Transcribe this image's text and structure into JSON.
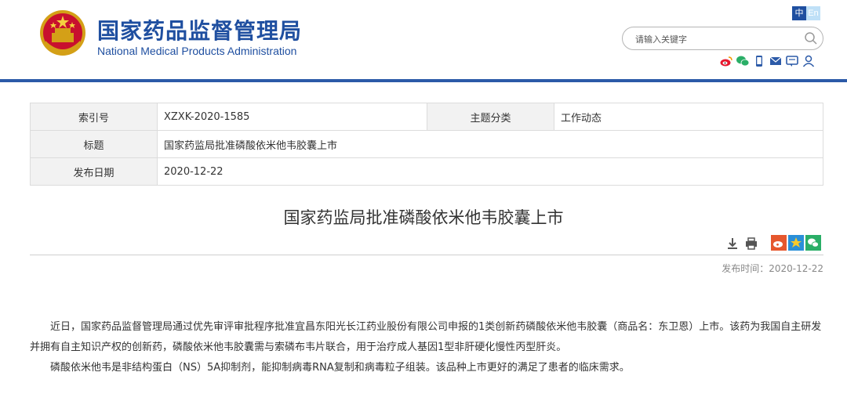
{
  "header": {
    "title_cn": "国家药品监督管理局",
    "title_en": "National Medical Products Administration",
    "lang_zh": "中",
    "lang_en": "En",
    "search_placeholder": "请输入关键字",
    "social_icons": [
      "weibo-icon",
      "wechat-icon",
      "mobile-icon",
      "mail-icon",
      "message-icon",
      "user-icon"
    ],
    "brand_color": "#1f4fa0",
    "bar_color": "#2c5aa8"
  },
  "info": {
    "index_label": "索引号",
    "index_value": "XZXK-2020-1585",
    "topic_label": "主题分类",
    "topic_value": "工作动态",
    "title_label": "标题",
    "title_value": "国家药监局批准磷酸依米他韦胶囊上市",
    "date_label": "发布日期",
    "date_value": "2020-12-22"
  },
  "article": {
    "title": "国家药监局批准磷酸依米他韦胶囊上市",
    "publish_time": "发布时间：2020-12-22",
    "tool_icons": [
      "download-icon",
      "print-icon"
    ],
    "share_icons": [
      "weibo-share-icon",
      "qzone-share-icon",
      "wechat-share-icon"
    ],
    "paragraphs": [
      "近日，国家药品监督管理局通过优先审评审批程序批准宜昌东阳光长江药业股份有限公司申报的1类创新药磷酸依米他韦胶囊（商品名：东卫恩）上市。该药为我国自主研发并拥有自主知识产权的创新药，磷酸依米他韦胶囊需与索磷布韦片联合，用于治疗成人基因1型非肝硬化慢性丙型肝炎。",
      "磷酸依米他韦是非结构蛋白（NS）5A抑制剂，能抑制病毒RNA复制和病毒粒子组装。该品种上市更好的满足了患者的临床需求。"
    ]
  }
}
